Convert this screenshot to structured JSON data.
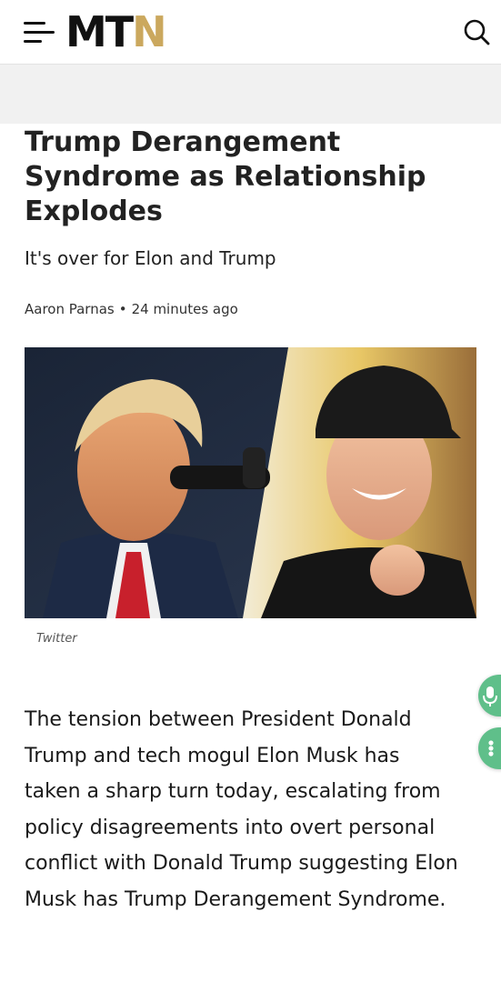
{
  "header": {
    "logo_main": "MT",
    "logo_accent": "N",
    "menu_icon": "hamburger-menu-icon",
    "search_icon": "search-icon"
  },
  "article": {
    "title": "Trump Derangement Syndrome as Relationship Explodes",
    "subtitle": "It's over for Elon and Trump",
    "author": "Aaron Parnas",
    "separator": "•",
    "time": "24 minutes ago",
    "image_caption": "Twitter",
    "body": "The tension between President Donald Trump and tech mogul Elon Musk has taken a sharp turn today, escalating from policy disagreements into overt personal conflict with Donald Trump suggesting Elon Musk has Trump Derangement Syndrome."
  },
  "floating": {
    "mic_icon": "microphone-icon",
    "more_icon": "more-options-icon"
  },
  "colors": {
    "accent": "#cba85e",
    "fab": "#5fbf8a"
  }
}
